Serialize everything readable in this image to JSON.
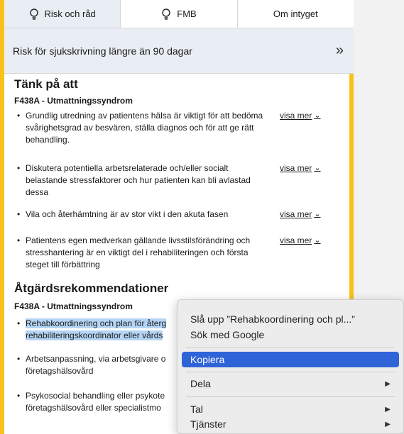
{
  "tabs": [
    {
      "label": "Risk och råd",
      "icon": "lightbulb-icon",
      "active": true
    },
    {
      "label": "FMB",
      "icon": "lightbulb-icon",
      "active": false
    },
    {
      "label": "Om intyget",
      "active": false
    }
  ],
  "risk_header": {
    "label": "Risk för sjukskrivning längre än 90 dagar",
    "expand_icon": "»"
  },
  "think": {
    "title": "Tänk på att",
    "diagnosis": "F438A - Utmattningssyndrom",
    "items": [
      "Grundlig utredning av patientens hälsa är viktigt för att bedöma svårighetsgrad av besvären, ställa diagnos och för att ge rätt behandling.",
      "Diskutera potentiella arbetsrelaterade och/eller socialt belastande stressfaktorer och hur patienten kan bli avlastad dessa",
      "Vila och återhämtning är av stor vikt i den akuta fasen",
      "Patientens egen medverkan gällande livsstilsförändring och stresshantering är en viktigt del i rehabiliteringen och första steget till förbättring"
    ],
    "more_label": "visa mer",
    "caret": "⌄"
  },
  "actions": {
    "title": "Åtgärdsrekommendationer",
    "diagnosis": "F438A - Utmattningssyndrom",
    "items": [
      {
        "line1": "Rehabkoordinering och plan för återg",
        "line2": "rehabiliteringskoordinator eller vårds"
      },
      {
        "line1": "Arbetsanpassning, via arbetsgivare o",
        "line2": "företagshälsovård"
      },
      {
        "line1": "Psykosocial behandling eller psykote",
        "line2": "företagshälsovård eller specialistmo"
      }
    ]
  },
  "context_menu": {
    "lookup": "Slå upp ”Rehabkoordinering och pl...”",
    "search": "Sök med Google",
    "copy": "Kopiera",
    "share": "Dela",
    "speech": "Tal",
    "services": "Tjänster",
    "submenu_arrow": "▶"
  },
  "colors": {
    "accent_border": "#f8c21a",
    "header_bg": "#e9eef4",
    "selection": "#b5d5f5",
    "menu_highlight": "#2f63d8"
  }
}
